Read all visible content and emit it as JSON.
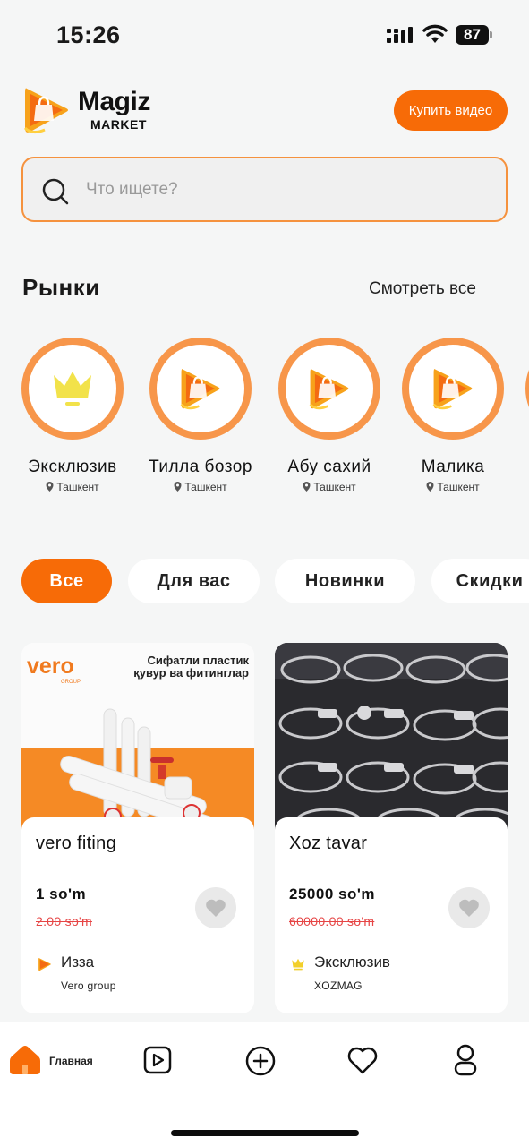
{
  "status_bar": {
    "time": "15:26",
    "battery": "87"
  },
  "header": {
    "logo_title": "Magiz",
    "logo_subtitle": "MARKET",
    "buy_video_label": "Купить видео"
  },
  "search": {
    "placeholder": "Что ищете?"
  },
  "markets": {
    "title": "Рынки",
    "see_all": "Смотреть все",
    "items": [
      {
        "name": "Эксклюзив",
        "location": "Ташкент",
        "icon": "crown-icon"
      },
      {
        "name": "Тилла бозор",
        "location": "Ташкент",
        "icon": "magiz-logo-icon"
      },
      {
        "name": "Абу сахий",
        "location": "Ташкент",
        "icon": "magiz-logo-icon"
      },
      {
        "name": "Малика",
        "location": "Ташкент",
        "icon": "magiz-logo-icon"
      }
    ]
  },
  "filters": {
    "chips": [
      "Все",
      "Для вас",
      "Новинки",
      "Скидки"
    ],
    "active": "Все"
  },
  "products": [
    {
      "title": "vero fiting",
      "price": "1 so'm",
      "old_price": "2.00 so'm",
      "market": "Изза",
      "seller": "Vero group",
      "image_brand": "vero",
      "image_brand_sub": "GROUP",
      "image_caption_1": "Сифатли пластик",
      "image_caption_2": "қувур ва фитинглар"
    },
    {
      "title": "Xoz tavar",
      "price": "25000 so'm",
      "old_price": "60000.00 so'm",
      "market": "Эксклюзив",
      "seller": "XOZMAG"
    }
  ],
  "bottom_nav": {
    "home_label": "Главная",
    "items": [
      "home-icon",
      "video-icon",
      "add-icon",
      "favorites-icon",
      "profile-icon"
    ]
  },
  "colors": {
    "accent": "#f76b07",
    "accent_light": "#f7964a",
    "price_old": "#e64545"
  }
}
